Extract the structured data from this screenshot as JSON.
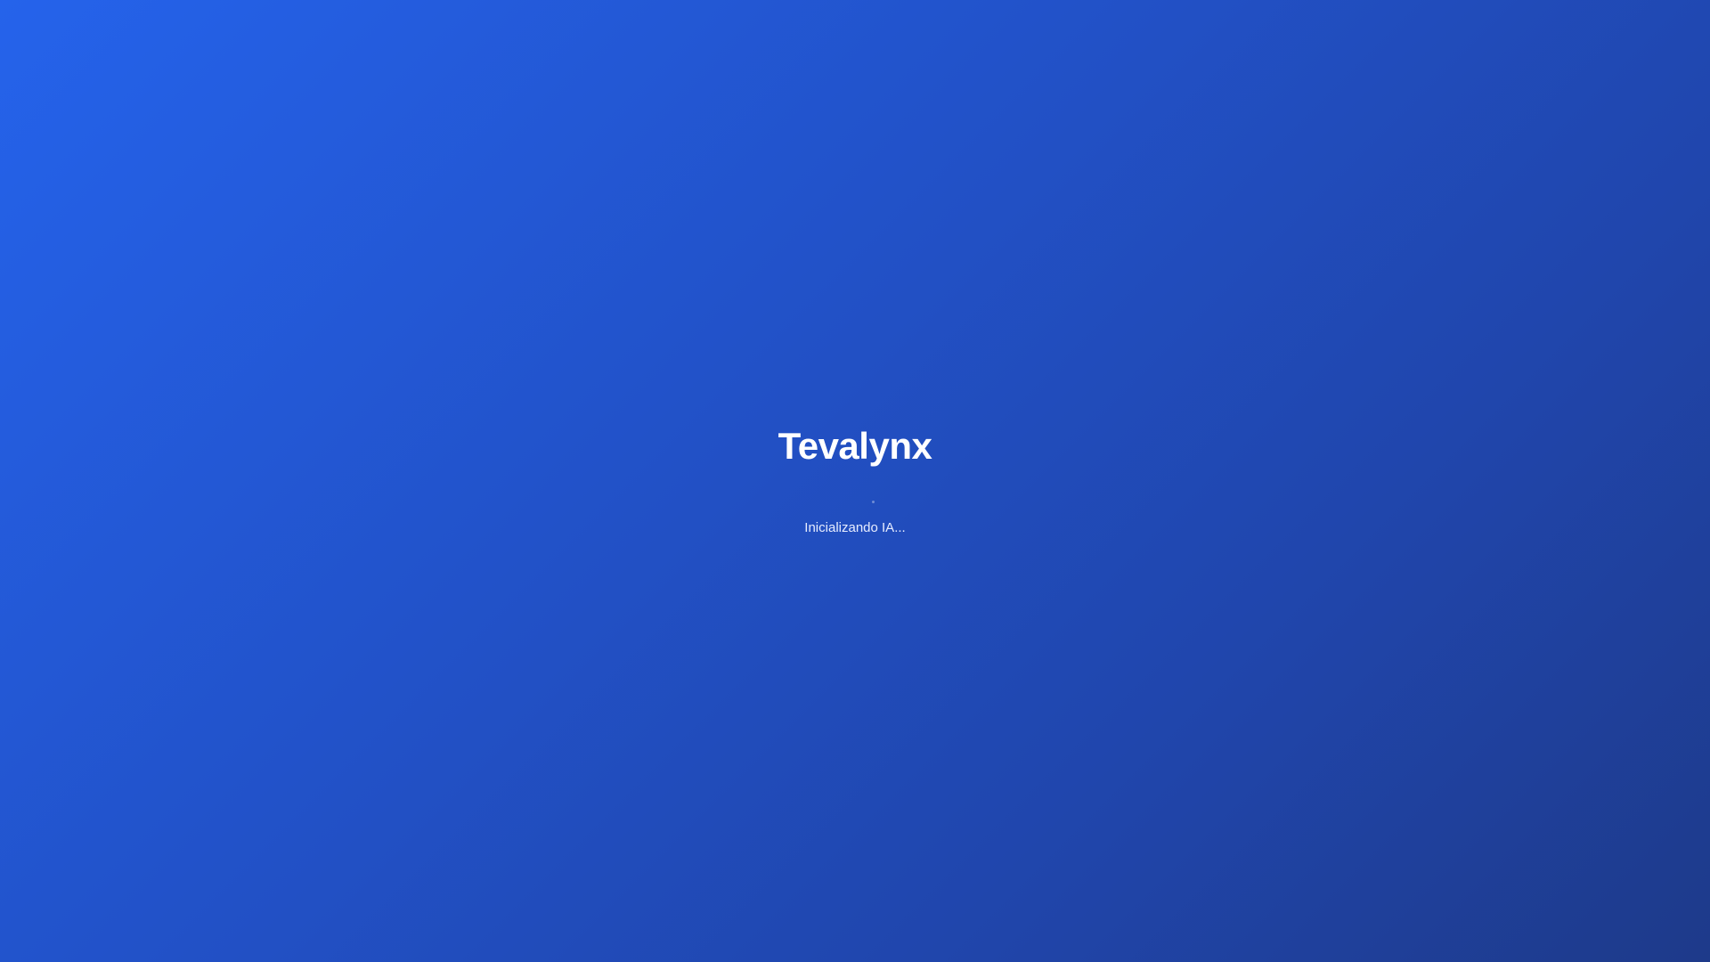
{
  "app": {
    "title": "Tevalynx"
  },
  "loading": {
    "status_text": "Inicializando IA...",
    "indicator_icon": "spinner-icon"
  },
  "colors": {
    "background_start": "#2563eb",
    "background_end": "#1e3a8a",
    "text": "#ffffff"
  }
}
